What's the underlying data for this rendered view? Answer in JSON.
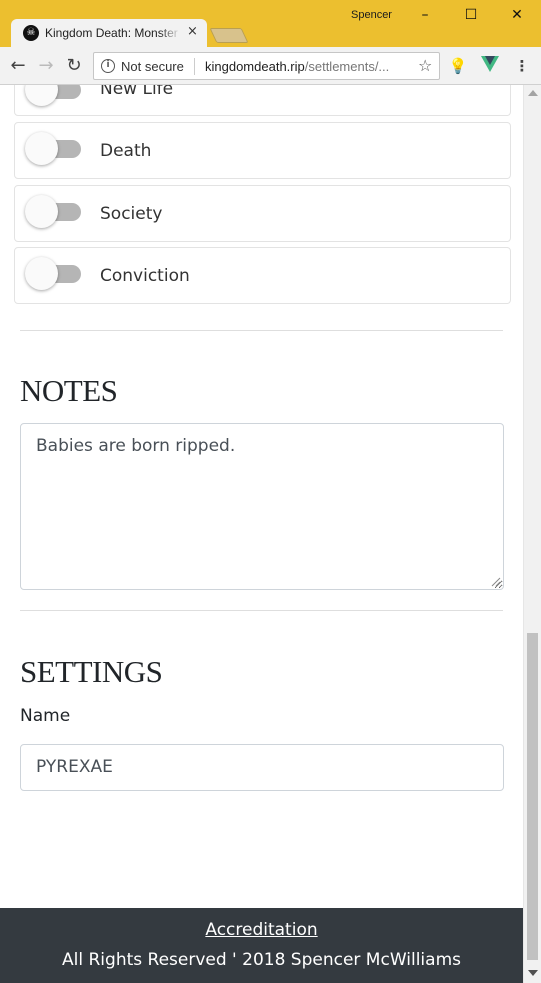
{
  "browser": {
    "tab_title": "Kingdom Death: Monster",
    "tab_close_icon": "×",
    "profile_name": "Spencer",
    "window_controls": {
      "minimize": "–",
      "maximize": "☐",
      "close": "✕"
    },
    "security_label": "Not secure",
    "url_host": "kingdomdeath.rip",
    "url_path": "/settlements/...",
    "icons": [
      "back-arrow-icon",
      "forward-arrow-icon",
      "reload-icon",
      "info-icon",
      "star-icon",
      "lightbulb-extension-icon",
      "vue-extension-icon",
      "menu-icon"
    ]
  },
  "principles": [
    {
      "label": "New Life",
      "enabled": false
    },
    {
      "label": "Death",
      "enabled": false
    },
    {
      "label": "Society",
      "enabled": false
    },
    {
      "label": "Conviction",
      "enabled": false
    }
  ],
  "notes": {
    "title": "NOTES",
    "value": "Babies are born ripped."
  },
  "settings": {
    "title": "SETTINGS",
    "name_label": "Name",
    "name_value": "PYREXAE"
  },
  "footer": {
    "link": "Accreditation",
    "copyright": "All Rights Reserved ' 2018 Spencer McWilliams"
  }
}
